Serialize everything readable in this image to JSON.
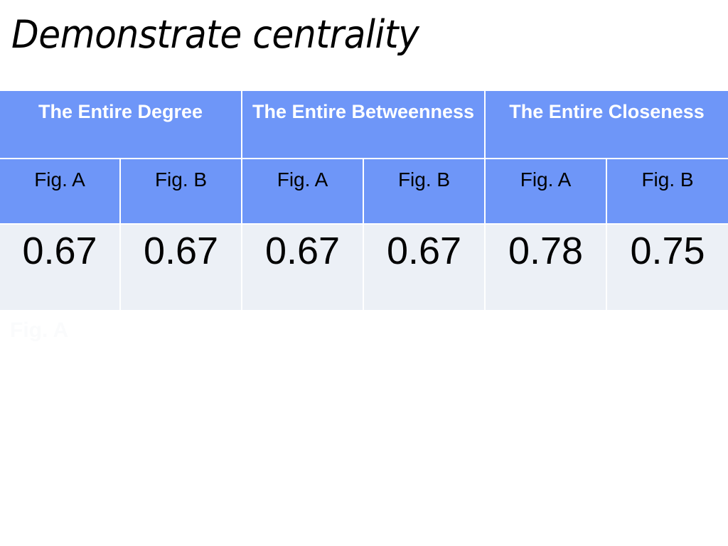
{
  "slide": {
    "title": "Demonstrate centrality",
    "background_color": "#ffffff"
  },
  "theme": {
    "header_blue": "#6e96f8",
    "value_row_bg": "#ecf0f6",
    "grid_line": "#ffffff",
    "header_text": "#ffffff",
    "body_text": "#000000"
  },
  "table": {
    "groups": [
      {
        "label": "The Entire Degree"
      },
      {
        "label": "The Entire Betweenness"
      },
      {
        "label": "The Entire Closeness"
      }
    ],
    "sub_headers": [
      {
        "label": "Fig. A"
      },
      {
        "label": "Fig. B"
      },
      {
        "label": "Fig. A"
      },
      {
        "label": "Fig. B"
      },
      {
        "label": "Fig. A"
      },
      {
        "label": "Fig. B"
      }
    ],
    "values": [
      {
        "value": "0.67"
      },
      {
        "value": "0.67"
      },
      {
        "value": "0.67"
      },
      {
        "value": "0.67"
      },
      {
        "value": "0.78"
      },
      {
        "value": "0.75"
      }
    ]
  },
  "artifacts": {
    "ghost_text": "Fig. A"
  }
}
